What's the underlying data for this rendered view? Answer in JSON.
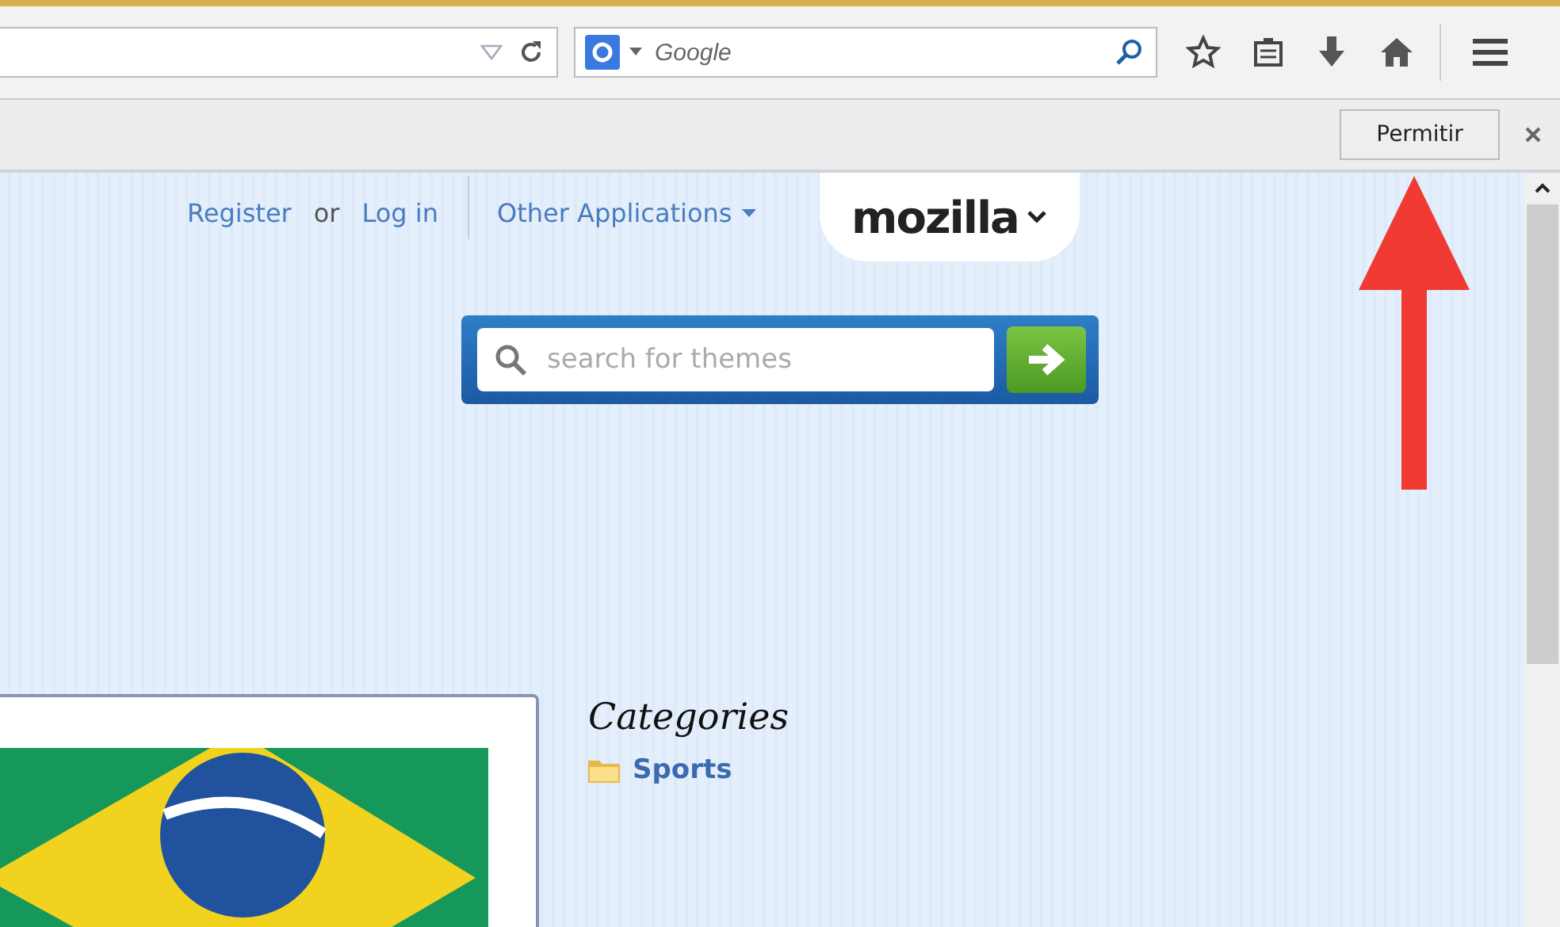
{
  "toolbar": {
    "search": {
      "placeholder": "Google"
    }
  },
  "notification_bar": {
    "button": "Permitir"
  },
  "header": {
    "register_link": "Register",
    "separator": "or",
    "login_link": "Log in",
    "apps_menu": "Other Applications",
    "logo": "mozilla"
  },
  "theme_search": {
    "placeholder": "search for themes"
  },
  "sidebar": {
    "title": "Categories",
    "items": [
      {
        "label": "Sports"
      }
    ]
  }
}
